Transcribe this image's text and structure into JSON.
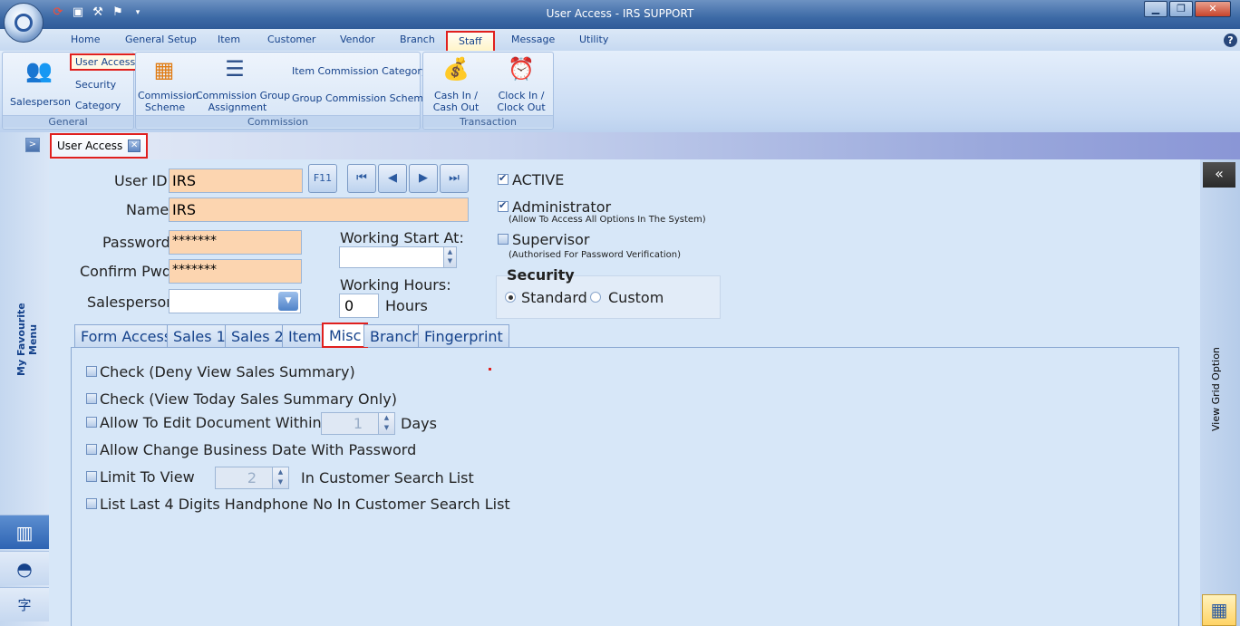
{
  "window": {
    "title": "User Access - IRS SUPPORT",
    "minimize_label": "▁",
    "restore_label": "❐",
    "close_label": "✕"
  },
  "qat": {
    "icons": [
      "refresh-icon",
      "save-icon",
      "tools-icon",
      "settings-icon",
      "dropdown-icon"
    ]
  },
  "ribbon_tabs": [
    "Home",
    "General Setup",
    "Item",
    "Customer",
    "Vendor",
    "Branch",
    "Staff",
    "Message",
    "Utility"
  ],
  "ribbon_tabs_selected": "Staff",
  "help_label": "?",
  "ribbon": {
    "general": {
      "label": "General",
      "salesperson": "Salesperson",
      "user_access": "User Access",
      "security": "Security",
      "category": "Category"
    },
    "commission": {
      "label": "Commission",
      "commission_scheme_1": "Commission",
      "commission_scheme_2": "Scheme",
      "group_assignment_1": "Commission Group",
      "group_assignment_2": "Assignment",
      "item_category": "Item Commission Category",
      "group_scheme": "Group Commission Scheme"
    },
    "transaction": {
      "label": "Transaction",
      "cash_1": "Cash In /",
      "cash_2": "Cash Out",
      "clock_1": "Clock In /",
      "clock_2": "Clock Out"
    }
  },
  "doc_tab": {
    "label": "User Access",
    "close": "✕"
  },
  "left_panel": {
    "expand": ">",
    "favourite": "My Favourite Menu"
  },
  "right_panel": {
    "collapse": "«",
    "grid_option": "View Grid Option"
  },
  "form": {
    "user_id_label": "User ID",
    "user_id_value": "IRS",
    "f11_label": "F11",
    "nav": [
      "⏮",
      "◀",
      "▶",
      "⏭"
    ],
    "name_label": "Name",
    "name_value": "IRS",
    "password_label": "Password",
    "password_value": "*******",
    "confirm_label": "Confirm Pwd",
    "confirm_value": "*******",
    "salesperson_label": "Salesperson",
    "salesperson_value": "",
    "working_start_label": "Working Start At:",
    "working_start_value": "",
    "working_hours_label": "Working Hours:",
    "working_hours_value": "0",
    "hours_label": "Hours",
    "active_label": "ACTIVE",
    "active_checked": true,
    "admin_label": "Administrator",
    "admin_note": "(Allow To Access All Options In The System)",
    "admin_checked": true,
    "supervisor_label": "Supervisor",
    "supervisor_note": "(Authorised For Password Verification)",
    "supervisor_checked": false,
    "security_title": "Security",
    "security_standard": "Standard",
    "security_custom": "Custom",
    "security_selected": "Standard"
  },
  "tabs": [
    "Form Access",
    "Sales 1",
    "Sales 2",
    "Item",
    "Misc",
    "Branch",
    "Fingerprint"
  ],
  "tabs_selected": "Misc",
  "misc": {
    "deny_view": "Check (Deny View Sales Summary)",
    "view_today": "Check (View Today Sales Summary Only)",
    "edit_within": "Allow To Edit Document Within",
    "edit_within_value": "1",
    "days": "Days",
    "change_date": "Allow Change Business Date With Password",
    "limit_view": "Limit To View",
    "limit_value": "2",
    "in_search": "In Customer Search List",
    "last4": "List Last 4 Digits Handphone No In Customer Search List"
  }
}
